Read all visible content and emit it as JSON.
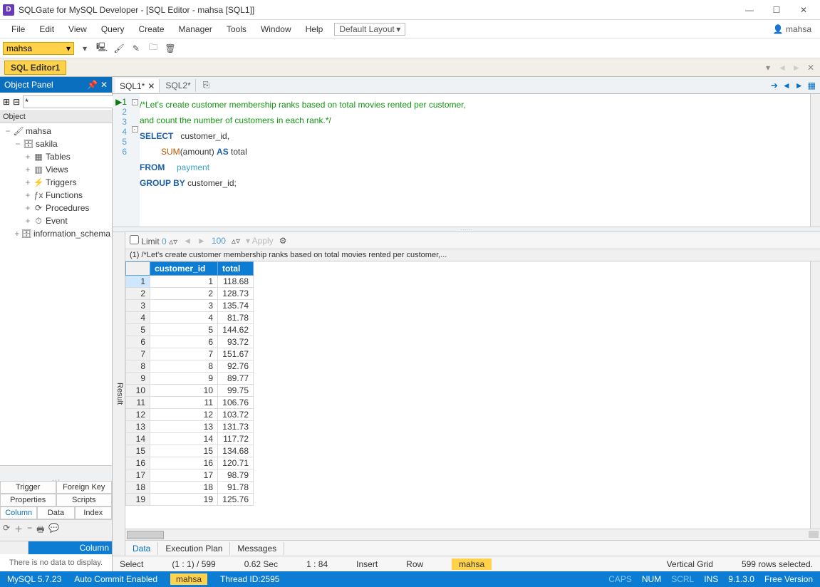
{
  "title": "SQLGate for MySQL Developer - [SQL Editor - mahsa [SQL1]]",
  "user": "mahsa",
  "menu": {
    "file": "File",
    "edit": "Edit",
    "view": "View",
    "query": "Query",
    "create": "Create",
    "manager": "Manager",
    "tools": "Tools",
    "window": "Window",
    "help": "Help",
    "layout": "Default Layout"
  },
  "toolbar": {
    "schema": "mahsa"
  },
  "editor_tab": {
    "t1": "SQL Editor1"
  },
  "code_tab": {
    "t1": "SQL1*",
    "t2": "SQL2*"
  },
  "op": {
    "title": "Object Panel",
    "filter": "*",
    "section": "Object",
    "tree": [
      {
        "ind": 0,
        "exp": "−",
        "ico": "🖌",
        "label": "mahsa"
      },
      {
        "ind": 1,
        "exp": "−",
        "ico": "🗄",
        "label": "sakila"
      },
      {
        "ind": 2,
        "exp": "+",
        "ico": "▦",
        "label": "Tables"
      },
      {
        "ind": 2,
        "exp": "+",
        "ico": "▥",
        "label": "Views"
      },
      {
        "ind": 2,
        "exp": "+",
        "ico": "⚡",
        "label": "Triggers"
      },
      {
        "ind": 2,
        "exp": "+",
        "ico": "ƒx",
        "label": "Functions"
      },
      {
        "ind": 2,
        "exp": "+",
        "ico": "⟳",
        "label": "Procedures"
      },
      {
        "ind": 2,
        "exp": "+",
        "ico": "⏱",
        "label": "Event"
      },
      {
        "ind": 1,
        "exp": "+",
        "ico": "🗄",
        "label": "information_schema"
      }
    ],
    "btns": {
      "trigger": "Trigger",
      "fk": "Foreign Key",
      "props": "Properties",
      "scripts": "Scripts",
      "column": "Column",
      "data": "Data",
      "index": "Index"
    },
    "colhdr": "Column",
    "empty": "There is no data to display."
  },
  "code": {
    "l1": "/*Let's create customer membership ranks based on total movies rented per customer,",
    "l2": "and count the number of customers in each rank.*/",
    "l3a": "SELECT",
    "l3b": "   customer_id,",
    "l4a": "         ",
    "l4b": "SUM",
    "l4c": "(amount) ",
    "l4d": "AS",
    "l4e": " total",
    "l5a": "FROM",
    "l5b": "     ",
    "l5c": "payment",
    "l6a": "GROUP BY",
    "l6b": " customer_id;"
  },
  "result": {
    "side": "Result",
    "limit_lbl": "Limit",
    "limit": "0",
    "page": "100",
    "apply": "Apply",
    "caption": "(1) /*Let's create customer membership ranks based on total movies rented per customer,...",
    "cols": {
      "c1": "customer_id",
      "c2": "total"
    },
    "rows": [
      {
        "n": "1",
        "c1": "1",
        "c2": "118.68"
      },
      {
        "n": "2",
        "c1": "2",
        "c2": "128.73"
      },
      {
        "n": "3",
        "c1": "3",
        "c2": "135.74"
      },
      {
        "n": "4",
        "c1": "4",
        "c2": "81.78"
      },
      {
        "n": "5",
        "c1": "5",
        "c2": "144.62"
      },
      {
        "n": "6",
        "c1": "6",
        "c2": "93.72"
      },
      {
        "n": "7",
        "c1": "7",
        "c2": "151.67"
      },
      {
        "n": "8",
        "c1": "8",
        "c2": "92.76"
      },
      {
        "n": "9",
        "c1": "9",
        "c2": "89.77"
      },
      {
        "n": "10",
        "c1": "10",
        "c2": "99.75"
      },
      {
        "n": "11",
        "c1": "11",
        "c2": "106.76"
      },
      {
        "n": "12",
        "c1": "12",
        "c2": "103.72"
      },
      {
        "n": "13",
        "c1": "13",
        "c2": "131.73"
      },
      {
        "n": "14",
        "c1": "14",
        "c2": "117.72"
      },
      {
        "n": "15",
        "c1": "15",
        "c2": "134.68"
      },
      {
        "n": "16",
        "c1": "16",
        "c2": "120.71"
      },
      {
        "n": "17",
        "c1": "17",
        "c2": "98.79"
      },
      {
        "n": "18",
        "c1": "18",
        "c2": "91.78"
      },
      {
        "n": "19",
        "c1": "19",
        "c2": "125.76"
      }
    ],
    "tabs": {
      "data": "Data",
      "plan": "Execution Plan",
      "msg": "Messages"
    }
  },
  "status1": {
    "select": "Select",
    "pos": "(1 : 1) / 599",
    "time": "0.62 Sec",
    "ratio": "1 : 84",
    "insert": "Insert",
    "row": "Row",
    "schema": "mahsa",
    "grid": "Vertical Grid",
    "sel": "599 rows selected."
  },
  "status2": {
    "db": "MySQL 5.7.23",
    "commit": "Auto Commit Enabled",
    "schema": "mahsa",
    "thread": "Thread ID:2595",
    "caps": "CAPS",
    "num": "NUM",
    "scrl": "SCRL",
    "ins": "INS",
    "ver": "9.1.3.0",
    "free": "Free Version"
  }
}
